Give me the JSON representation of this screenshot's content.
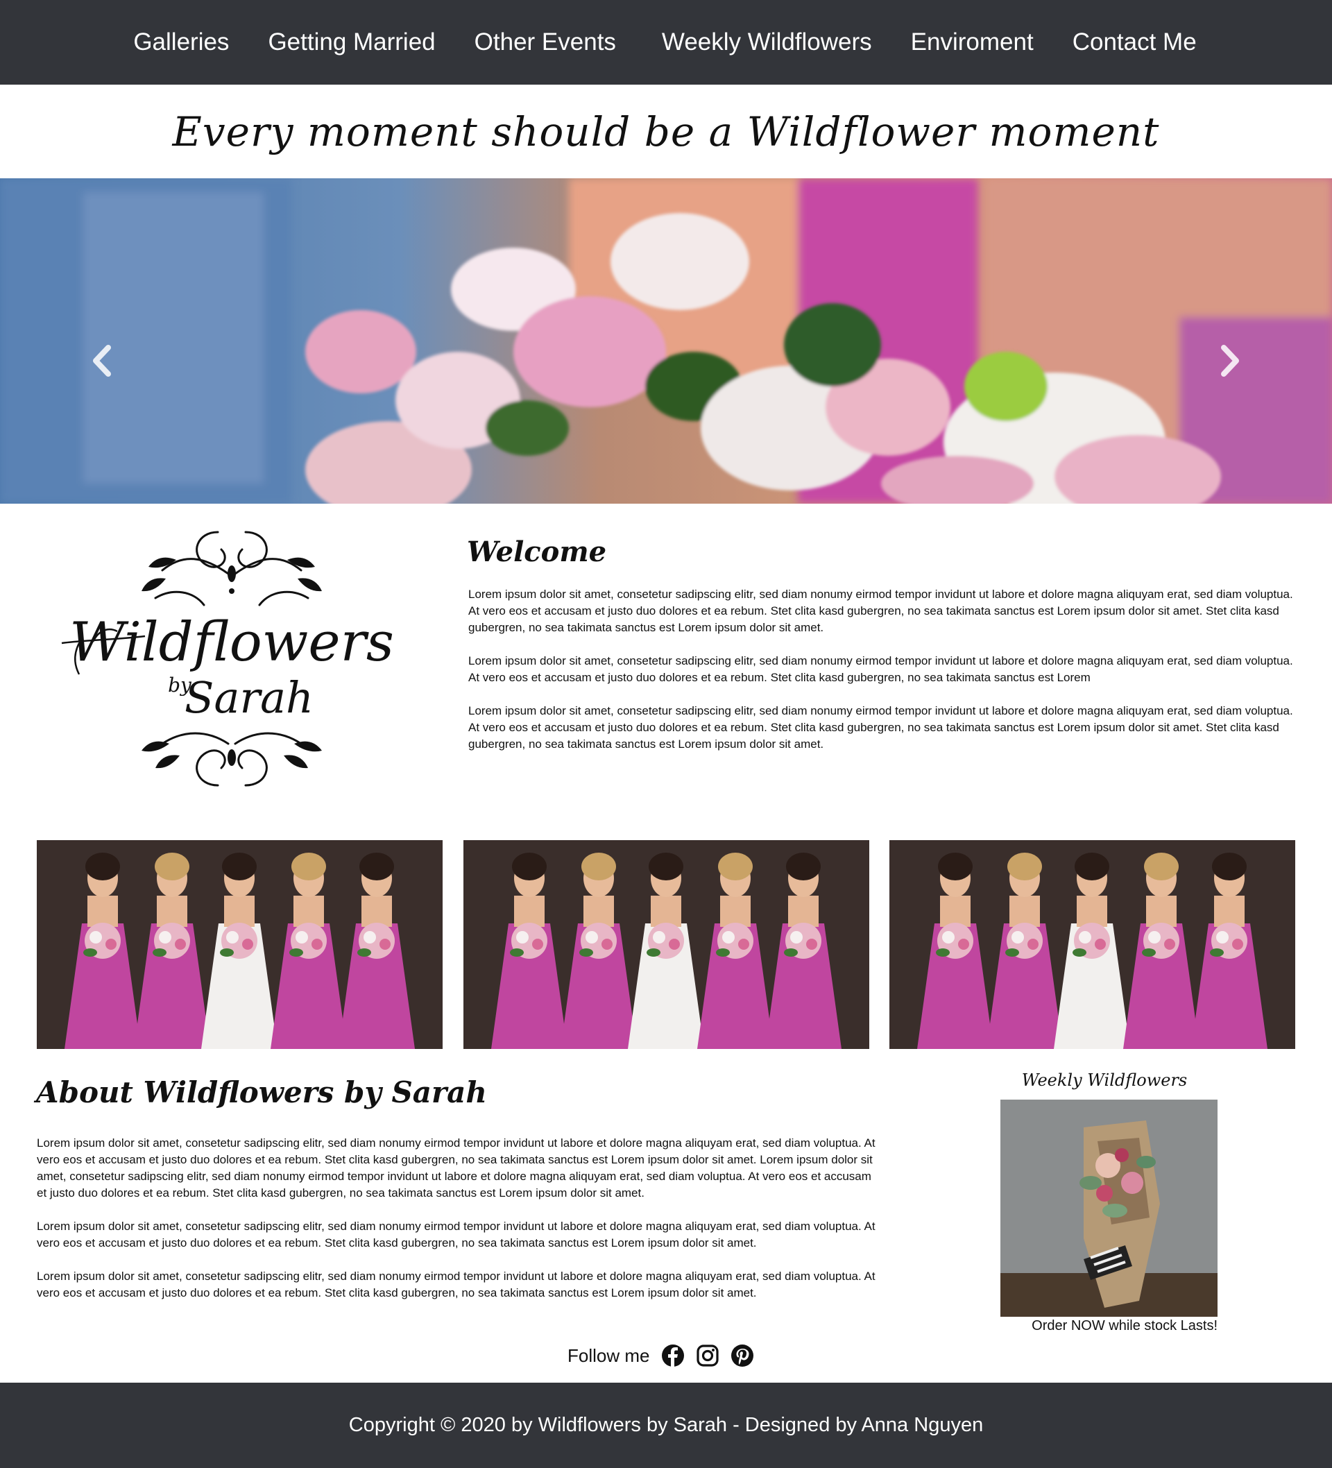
{
  "nav": {
    "items": [
      "Galleries",
      "Getting Married",
      "Other Events",
      "Weekly Wildflowers",
      "Enviroment",
      "Contact Me"
    ]
  },
  "tagline": "Every moment should be a Wildflower moment",
  "hero": {
    "prev_icon": "chevron-left-icon",
    "next_icon": "chevron-right-icon"
  },
  "logo": {
    "line1": "Wildflowers",
    "line2": "by",
    "line3": "Sarah"
  },
  "welcome": {
    "title": "Welcome",
    "paragraphs": [
      "Lorem ipsum dolor sit amet, consetetur sadipscing elitr, sed diam nonumy eirmod tempor invidunt ut labore et dolore magna aliquyam erat, sed diam voluptua. At vero eos et accusam et justo duo dolores et ea rebum. Stet clita kasd gubergren, no sea takimata sanctus est Lorem ipsum dolor sit amet. Stet clita kasd gubergren, no sea takimata sanctus est Lorem ipsum dolor sit amet.",
      "Lorem ipsum dolor sit amet, consetetur sadipscing elitr, sed diam nonumy eirmod tempor invidunt ut labore et dolore magna aliquyam erat, sed diam voluptua. At vero eos et accusam et justo duo dolores et ea rebum. Stet clita kasd gubergren, no sea takimata sanctus est Lorem",
      "Lorem ipsum dolor sit amet, consetetur sadipscing elitr, sed diam nonumy eirmod tempor invidunt ut labore et dolore magna aliquyam erat, sed diam voluptua. At vero eos et accusam et justo duo dolores et ea rebum. Stet clita kasd gubergren, no sea takimata sanctus est Lorem ipsum dolor sit amet. Stet clita kasd gubergren, no sea takimata sanctus est Lorem ipsum dolor sit amet."
    ]
  },
  "about": {
    "title": "About Wildflowers by Sarah",
    "paragraphs": [
      "Lorem ipsum dolor sit amet, consetetur sadipscing elitr, sed diam nonumy eirmod tempor invidunt ut labore et dolore magna aliquyam erat, sed diam voluptua. At vero eos et accusam et justo duo dolores et ea rebum. Stet clita kasd gubergren, no sea takimata sanctus est Lorem ipsum dolor sit amet. Lorem ipsum dolor sit amet, consetetur sadipscing elitr, sed diam nonumy eirmod tempor invidunt ut labore et dolore magna aliquyam erat, sed diam voluptua. At vero eos et accusam et justo duo dolores et ea rebum. Stet clita kasd gubergren, no sea takimata sanctus est Lorem ipsum dolor sit amet.",
      "Lorem ipsum dolor sit amet, consetetur sadipscing elitr, sed diam nonumy eirmod tempor invidunt ut labore et dolore magna aliquyam erat, sed diam voluptua. At vero eos et accusam et justo duo dolores et ea rebum. Stet clita kasd gubergren, no sea takimata sanctus est Lorem ipsum dolor sit amet.",
      "Lorem ipsum dolor sit amet, consetetur sadipscing elitr, sed diam nonumy eirmod tempor invidunt ut labore et dolore magna aliquyam erat, sed diam voluptua. At vero eos et accusam et justo duo dolores et ea rebum. Stet clita kasd gubergren, no sea takimata sanctus est Lorem ipsum dolor sit amet."
    ]
  },
  "weekly": {
    "title": "Weekly Wildflowers",
    "caption": "Order NOW while stock Lasts!"
  },
  "follow": {
    "label": "Follow me",
    "icons": [
      "facebook-icon",
      "instagram-icon",
      "pinterest-icon"
    ]
  },
  "footer": {
    "text": "Copyright © 2020 by Wildflowers by Sarah - Designed by Anna Nguyen"
  },
  "colors": {
    "bar": "#33353a",
    "dress": "#c0469f",
    "hero_blue": "#3a6a9e"
  }
}
